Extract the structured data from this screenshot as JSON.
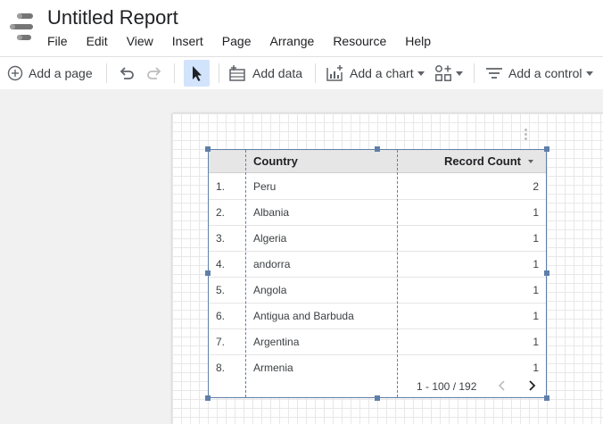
{
  "app": {
    "title": "Untitled Report",
    "logo_icon": "data-studio-logo-icon"
  },
  "menu": [
    "File",
    "Edit",
    "View",
    "Insert",
    "Page",
    "Arrange",
    "Resource",
    "Help"
  ],
  "toolbar": {
    "add_page": "Add a page",
    "add_data": "Add data",
    "add_chart": "Add a chart",
    "add_control": "Add a control",
    "active_tool": "select"
  },
  "table": {
    "columns": [
      "Country",
      "Record Count"
    ],
    "sort_indicator": "descending",
    "rows": [
      {
        "index": "1.",
        "country": "Peru",
        "count": "2"
      },
      {
        "index": "2.",
        "country": "Albania",
        "count": "1"
      },
      {
        "index": "3.",
        "country": "Algeria",
        "count": "1"
      },
      {
        "index": "4.",
        "country": "andorra",
        "count": "1"
      },
      {
        "index": "5.",
        "country": "Angola",
        "count": "1"
      },
      {
        "index": "6.",
        "country": "Antigua and Barbuda",
        "count": "1"
      },
      {
        "index": "7.",
        "country": "Argentina",
        "count": "1"
      },
      {
        "index": "8.",
        "country": "Armenia",
        "count": "1"
      }
    ],
    "pagination": "1 - 100 / 192"
  },
  "colors": {
    "selection": "#5f7fa8",
    "active_tool_bg": "#d2e3fc",
    "header_bg": "#e6e6e6",
    "canvas_bg": "#f1f1f1"
  }
}
